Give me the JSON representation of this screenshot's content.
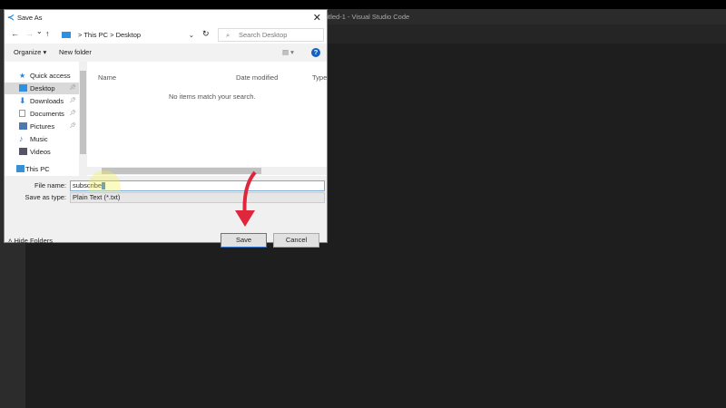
{
  "vscode": {
    "title": "Untitled-1 - Visual Studio Code"
  },
  "dialog": {
    "title": "Save As",
    "close": "✕",
    "nav": {
      "back": "←",
      "forward": "→",
      "recent": "⌄",
      "up": "↑",
      "refresh": "↻",
      "path": [
        "This PC",
        "Desktop"
      ],
      "separator": ">",
      "search_placeholder": "Search Desktop"
    },
    "toolbar": {
      "organize": "Organize ▾",
      "new_folder": "New folder",
      "view": "▤ ▾",
      "help": "?"
    },
    "sidebar": [
      {
        "label": "Quick access",
        "icon": "star-icon",
        "pinned": false,
        "color": "#2f7fd6"
      },
      {
        "label": "Desktop",
        "icon": "desktop-icon",
        "pinned": true,
        "color": "#2f8fe0"
      },
      {
        "label": "Downloads",
        "icon": "download-icon",
        "pinned": true,
        "color": "#2f7fd6"
      },
      {
        "label": "Documents",
        "icon": "document-icon",
        "pinned": true,
        "color": "#9aa"
      },
      {
        "label": "Pictures",
        "icon": "pictures-icon",
        "pinned": true,
        "color": "#4a7ab0"
      },
      {
        "label": "Music",
        "icon": "music-icon",
        "pinned": false,
        "color": "#2f7fd6"
      },
      {
        "label": "Videos",
        "icon": "videos-icon",
        "pinned": false,
        "color": "#556"
      },
      {
        "label": "This PC",
        "icon": "computer-icon",
        "pinned": false,
        "color": "#3a8fd0"
      }
    ],
    "columns": [
      "Name",
      "Date modified",
      "Type"
    ],
    "empty_message": "No items match your search.",
    "file_name_label": "File name:",
    "file_name": "subscribe",
    "save_type_label": "Save as type:",
    "save_type": "Plain Text (*.txt)",
    "hide_folders": "Hide Folders",
    "save": "Save",
    "cancel": "Cancel"
  }
}
